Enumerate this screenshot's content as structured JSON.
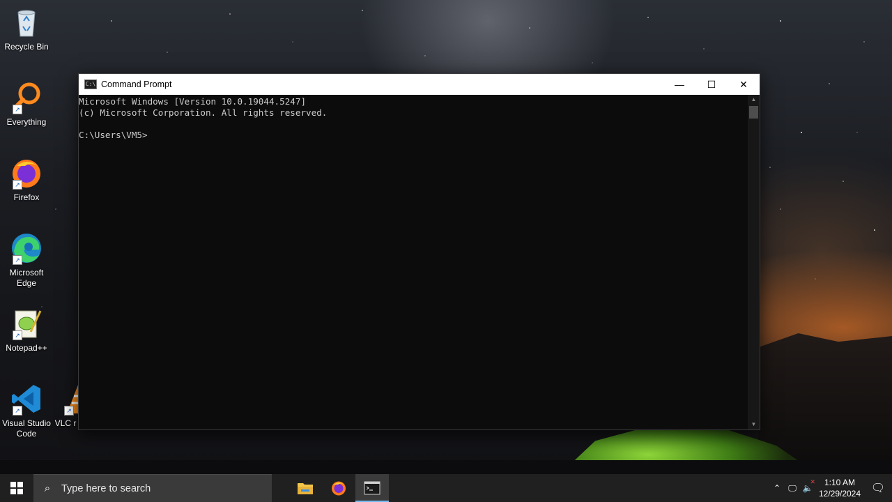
{
  "desktop": {
    "icons": [
      {
        "label": "Recycle Bin",
        "icon": "recycle-bin-icon"
      },
      {
        "label": "Everything",
        "icon": "everything-search-icon"
      },
      {
        "label": "Firefox",
        "icon": "firefox-icon"
      },
      {
        "label": "Microsoft Edge",
        "icon": "edge-icon"
      },
      {
        "label": "Notepad++",
        "icon": "notepadpp-icon"
      },
      {
        "label": "Visual Studio Code",
        "icon": "vscode-icon"
      },
      {
        "label": "VLC r player",
        "icon": "vlc-icon"
      }
    ]
  },
  "window": {
    "title": "Command Prompt",
    "minimize_glyph": "—",
    "maximize_glyph": "☐",
    "close_glyph": "✕",
    "console_lines": [
      "Microsoft Windows [Version 10.0.19044.5247]",
      "(c) Microsoft Corporation. All rights reserved.",
      "",
      "C:\\Users\\VM5>"
    ]
  },
  "taskbar": {
    "search_placeholder": "Type here to search",
    "apps": [
      {
        "name": "file-explorer-icon",
        "active": false
      },
      {
        "name": "firefox-icon",
        "active": false
      },
      {
        "name": "command-prompt-icon",
        "active": true
      }
    ],
    "clock": {
      "time": "1:10 AM",
      "date": "12/29/2024"
    }
  },
  "colors": {
    "console_bg": "#0c0c0c",
    "console_text": "#cccccc",
    "taskbar_bg": "#202020",
    "active_indicator": "#76b9ed"
  }
}
